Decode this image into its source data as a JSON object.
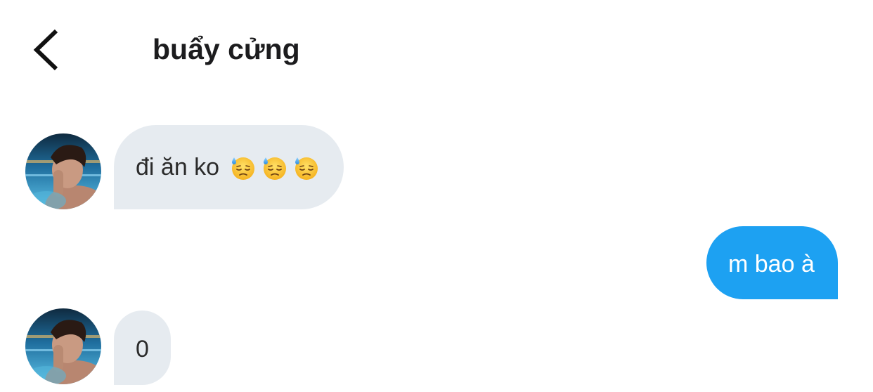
{
  "header": {
    "title": "buẩy cửng"
  },
  "messages": [
    {
      "direction": "incoming",
      "text": "đi ăn ko",
      "emojis": [
        "downcast-face-with-sweat-icon",
        "downcast-face-with-sweat-icon",
        "downcast-face-with-sweat-icon"
      ]
    },
    {
      "direction": "outgoing",
      "text": "m bao à"
    },
    {
      "direction": "incoming",
      "text": "0"
    }
  ],
  "colors": {
    "incoming_bubble": "#e6ebf0",
    "outgoing_bubble": "#1da1f2",
    "title_text": "#1c1c1e"
  },
  "icons": {
    "back": "chevron-left-icon",
    "avatar": "contact-avatar"
  }
}
